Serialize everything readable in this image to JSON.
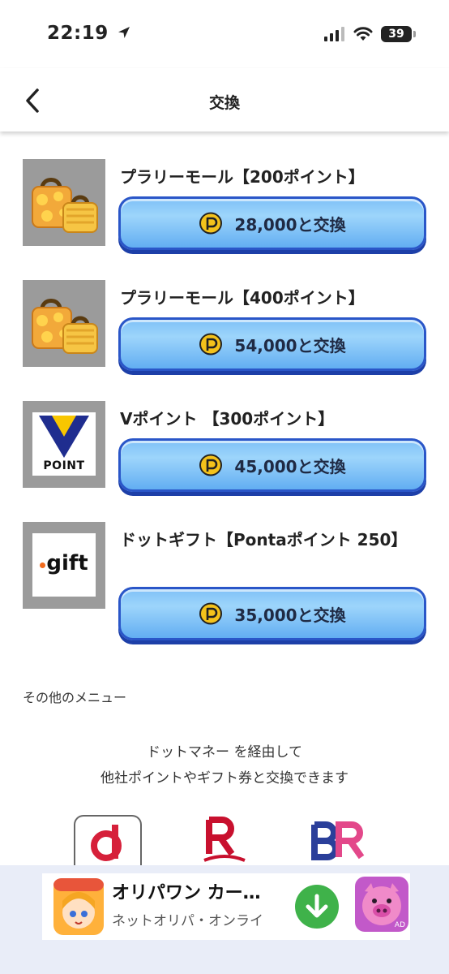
{
  "status_bar": {
    "time": "22:19",
    "battery": "39"
  },
  "nav": {
    "title": "交換"
  },
  "items": [
    {
      "title": "プラリーモール【200ポイント】",
      "button_label": "28,000と交換"
    },
    {
      "title": "プラリーモール【400ポイント】",
      "button_label": "54,000と交換"
    },
    {
      "title": "Vポイント 【300ポイント】",
      "button_label": "45,000と交換",
      "logo_text": "POINT"
    },
    {
      "title": "ドットギフト【Pontaポイント 250】",
      "button_label": "35,000と交換",
      "logo_text": "gift"
    }
  ],
  "other_menu": {
    "heading": "その他のメニュー",
    "desc_line1": "ドットマネー を経由して",
    "desc_line2": "他社ポイントやギフト券と交換できます"
  },
  "ad": {
    "title": "オリパワン カー…",
    "subtitle": "ネットオリパ・オンライ",
    "badge": "AD"
  },
  "colors": {
    "button_fill": "#8ccbf8",
    "button_border": "#2a56c8",
    "point_icon": "#f4c21b",
    "v_point_blue": "#1f2d8f",
    "v_point_yellow": "#f8c600",
    "d_red": "#d6203a",
    "r_red": "#c8102e",
    "br_blue": "#2b3f9a",
    "br_pink": "#e3488a",
    "ad_bg": "#e9edf8",
    "download_green": "#3fb24a",
    "pig_pink": "#f08ac9"
  }
}
